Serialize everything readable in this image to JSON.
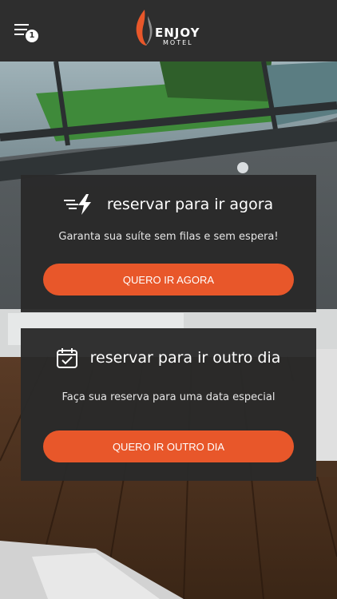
{
  "header": {
    "notification_count": "1",
    "logo_main": "ENJOY",
    "logo_sub": "MOTEL"
  },
  "cards": [
    {
      "icon": "fast-lightning-icon",
      "title": "reservar para ir agora",
      "subtitle": "Garanta sua suíte sem filas e sem espera!",
      "button_label": "QUERO IR AGORA"
    },
    {
      "icon": "calendar-check-icon",
      "title": "reservar para ir outro dia",
      "subtitle": "Faça sua reserva para uma data especial",
      "button_label": "QUERO IR OUTRO DIA"
    }
  ],
  "colors": {
    "accent": "#e8572a",
    "header_bg": "#2e2e2e",
    "card_bg": "#2a2a2a"
  }
}
